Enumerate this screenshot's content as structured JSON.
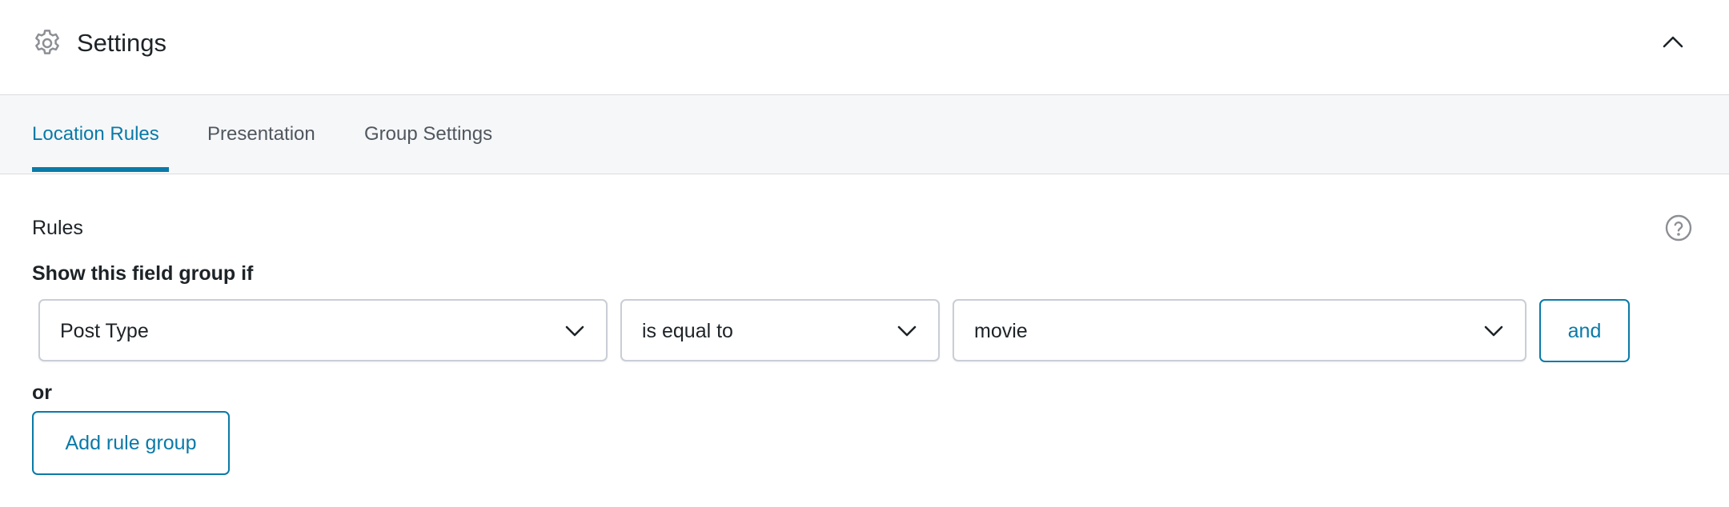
{
  "header": {
    "title": "Settings",
    "icon": "gear-icon",
    "collapse_icon": "chevron-up-icon"
  },
  "tabs": [
    {
      "label": "Location Rules",
      "active": true
    },
    {
      "label": "Presentation",
      "active": false
    },
    {
      "label": "Group Settings",
      "active": false
    }
  ],
  "rules": {
    "label": "Rules",
    "help_icon": "question-circle-icon",
    "condition_label": "Show this field group if",
    "rule_groups": [
      {
        "param": "Post Type",
        "operator": "is equal to",
        "value": "movie",
        "and_label": "and"
      }
    ],
    "or_label": "or",
    "add_group_label": "Add rule group"
  },
  "colors": {
    "accent": "#0a7aa8",
    "text": "#1d2327",
    "muted": "#50575e",
    "tab_bar_bg": "#f6f7f9",
    "border": "#c9ced6"
  }
}
